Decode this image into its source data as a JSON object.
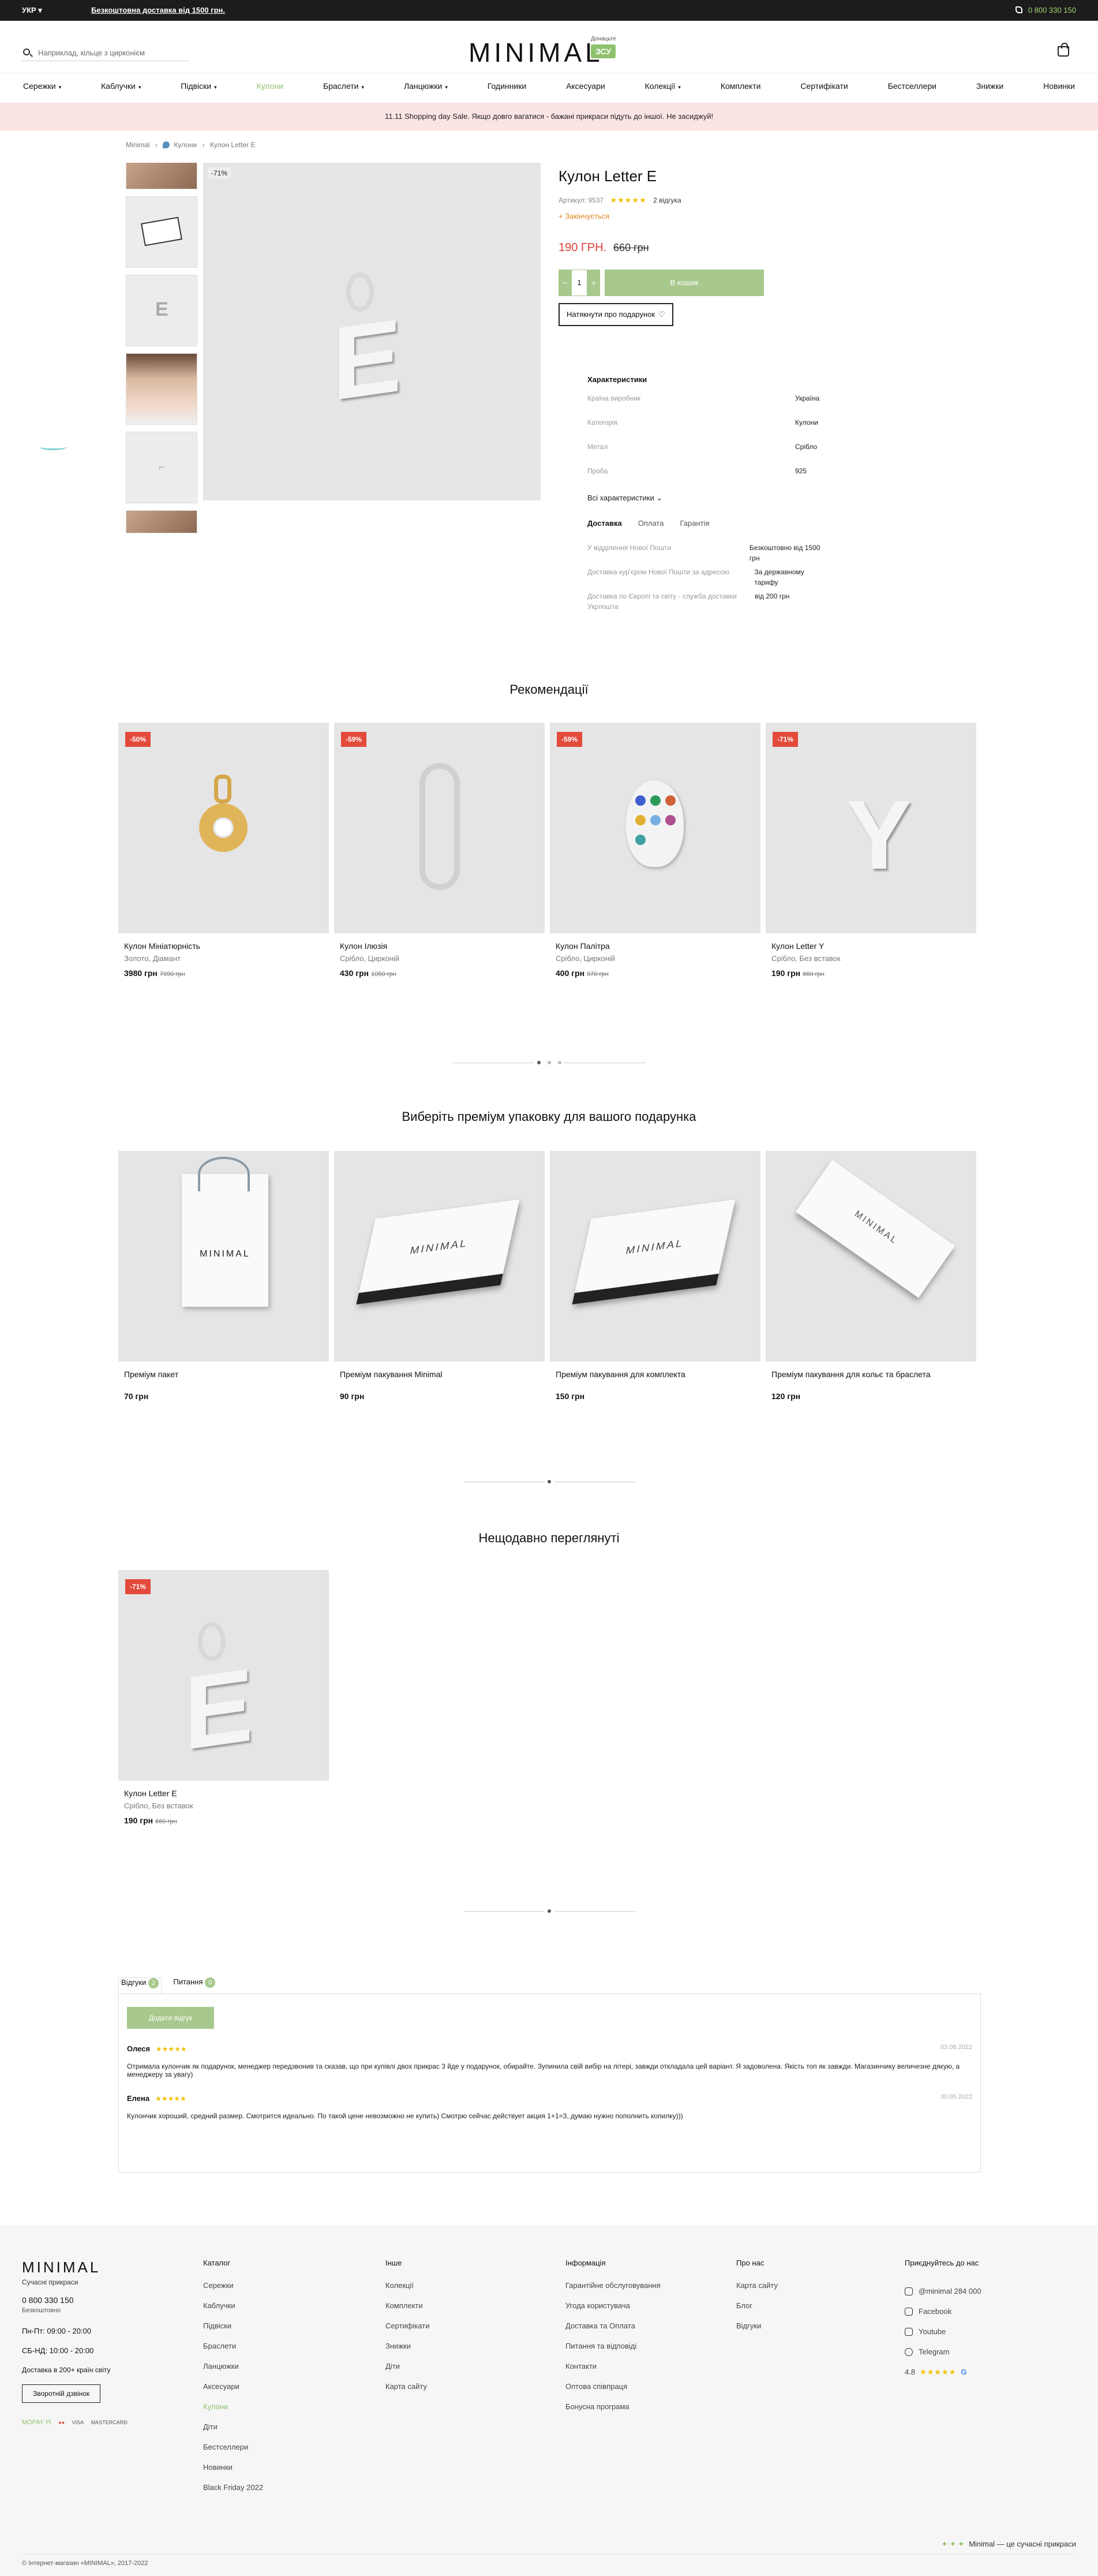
{
  "topbar": {
    "lang": "УКР ▾",
    "promo": "Безкоштовна доставка від 1500 грн.",
    "phone": "0 800 330 150"
  },
  "header": {
    "search_placeholder": "Наприклад, кільце з цирконієм",
    "logo": "MINIMAL",
    "badge_top": "Донацьте",
    "badge_box": "ЗСУ"
  },
  "nav": [
    {
      "label": "Сережки",
      "caret": true
    },
    {
      "label": "Каблучки",
      "caret": true
    },
    {
      "label": "Підвіски",
      "caret": true
    },
    {
      "label": "Кулони",
      "caret": false,
      "active": true
    },
    {
      "label": "Браслети",
      "caret": true
    },
    {
      "label": "Ланцюжки",
      "caret": true
    },
    {
      "label": "Годинники",
      "caret": false
    },
    {
      "label": "Аксесуари",
      "caret": false
    },
    {
      "label": "Колекції",
      "caret": true
    },
    {
      "label": "Комплекти",
      "caret": false
    },
    {
      "label": "Сертифікати",
      "caret": false
    },
    {
      "label": "Бестселлери",
      "caret": false
    },
    {
      "label": "Знижки",
      "caret": false
    },
    {
      "label": "Новинки",
      "caret": false
    }
  ],
  "sale_banner": "11.11 Shopping day Sale. Якщо довго вагатися - бажані прикраси підуть до іншої. Не засиджуй!",
  "breadcrumb": [
    "Minimal",
    "Кулони",
    "Кулон Letter E"
  ],
  "gallery": {
    "discount": "-71%"
  },
  "product": {
    "title": "Кулон Letter E",
    "sku": "Артикул: 9537",
    "rating_stars": "★★★★★",
    "reviews": "2 відгука",
    "stock": "+ Закінчується",
    "price_now": "190 ГРН.",
    "price_old": "660 грн",
    "qty": "1",
    "qty_minus": "−",
    "qty_plus": "+",
    "add_to_cart": "В кошик",
    "gift_hint": "Натякнути про подарунок",
    "heart": "♡"
  },
  "specs": {
    "title": "Характеристики",
    "rows": [
      {
        "k": "Країна виробник",
        "v": "Україна"
      },
      {
        "k": "Категорія",
        "v": "Кулони"
      },
      {
        "k": "Метал",
        "v": "Срібло"
      },
      {
        "k": "Проба",
        "v": "925"
      }
    ],
    "more": "Всі характеристики ⌄",
    "tabs": [
      "Доставка",
      "Оплата",
      "Гарантія"
    ],
    "delivery": [
      {
        "k": "У відділення Нової Пошти",
        "v": "Безкоштовно від 1500 грн"
      },
      {
        "k": "Доставка кур'єром Нової Пошти за адресою",
        "v": "За державному тарифу"
      },
      {
        "k": "Доставка по Європі та світу - служба доставки Укрпошта",
        "v": "від 200 грн"
      }
    ]
  },
  "recommendations": {
    "title": "Рекомендації",
    "items": [
      {
        "badge": "-50%",
        "name": "Кулон Мініатюрність",
        "meta": "Золото, Діамант",
        "price": "3980 грн",
        "old": "7990 грн"
      },
      {
        "badge": "-59%",
        "name": "Кулон Ілюзія",
        "meta": "Срібло, Цирконій",
        "price": "430 грн",
        "old": "1050 грн"
      },
      {
        "badge": "-59%",
        "name": "Кулон Палітра",
        "meta": "Срібло, Цирконій",
        "price": "400 грн",
        "old": "970 грн"
      },
      {
        "badge": "-71%",
        "name": "Кулон Letter Y",
        "meta": "Срібло, Без вставок",
        "price": "190 грн",
        "old": "660 грн"
      }
    ]
  },
  "packaging": {
    "title": "Виберіть преміум упаковку для вашого подарунка",
    "items": [
      {
        "name": "Преміум пакет",
        "price": "70 грн",
        "brand": "MINIMAL"
      },
      {
        "name": "Преміум пакування Minimal",
        "price": "90 грн",
        "brand": "MINIMAL"
      },
      {
        "name": "Преміум пакування для комплекта",
        "price": "150 грн",
        "brand": "MINIMAL"
      },
      {
        "name": "Преміум пакування для кольє та браслета",
        "price": "120 грн",
        "brand": "MINIMAL"
      }
    ]
  },
  "recent": {
    "title": "Нещодавно переглянуті",
    "items": [
      {
        "badge": "-71%",
        "name": "Кулон Letter E",
        "meta": "Срібло, Без вставок",
        "price": "190 грн",
        "old": "660 грн"
      }
    ]
  },
  "reviews": {
    "tab_reviews": "Відгуки",
    "tab_reviews_count": "2",
    "tab_questions": "Питання",
    "tab_questions_count": "0",
    "add_button": "Додати відгук",
    "items": [
      {
        "author": "Олеся",
        "stars": "★★★★★",
        "date": "03.08.2022",
        "text": "Отримала кулончик як подарунок, менеджер передзвонив та сказав, що при купівлі двох прикрас 3 йде у подарунок, обирайте. Зупинила свій вибір на літері, завжди откладала цей варіант. Я задоволена. Якість топ як завжди. Магазинчику величезне дякую, а менеджеру за увагу)"
      },
      {
        "author": "Елена",
        "stars": "★★★★★",
        "date": "30.05.2022",
        "text": "Кулончик хороший, средний размер. Смотрится идеально. По такой цене невозможно не купить) Смотрю сейчас действует акция 1+1=3, думаю нужно пополнить копилку)))"
      }
    ]
  },
  "footer": {
    "logo": "MINIMAL",
    "sub": "Сучасні прикраси",
    "phone": "0 800 330 150",
    "free": "Безкоштовно",
    "hours1": "Пн-Пт: 09:00 - 20:00",
    "hours2": "СБ-НД: 10:00 - 20:00",
    "delivery": "Доставка в 200+ країн світу",
    "callback": "Зворотній дзвінок",
    "payments": [
      "MOPAY Pi",
      "●●",
      "VISA",
      "MASTERCARD"
    ],
    "cols": [
      {
        "title": "Каталог",
        "items": [
          "Сережки",
          "Каблучки",
          "Підвіски",
          "Браслети",
          "Ланцюжки",
          "Аксесуари",
          "Кулони",
          "Діти",
          "Бестселлери",
          "Новинки",
          "Black Friday 2022"
        ],
        "active": 6
      },
      {
        "title": "Інше",
        "items": [
          "Колекції",
          "Комплекти",
          "Сертифікати",
          "Знижки",
          "Діти",
          "Карта сайту"
        ]
      },
      {
        "title": "Інформація",
        "items": [
          "Гарантійне обслуговування",
          "Угода користувача",
          "Доставка та Оплата",
          "Питання та відповіді",
          "Контакти",
          "Оптова співпраця",
          "Бонусна програма"
        ]
      },
      {
        "title": "Про нас",
        "items": [
          "Карта сайту",
          "Блог",
          "Відгуки"
        ]
      }
    ],
    "social_title": "Приєднуйтесь до нас",
    "social": [
      "@minimal  284 000",
      "Facebook",
      "Youtube",
      "Telegram"
    ],
    "rating": "4.8",
    "rating_stars": "★★★★★",
    "tagline": "Minimal — це сучасні прикраси",
    "tagline_stars": "✦ ✦ ✦",
    "copyright": "© Інтернет-магазин «MINIMAL», 2017-2022"
  }
}
